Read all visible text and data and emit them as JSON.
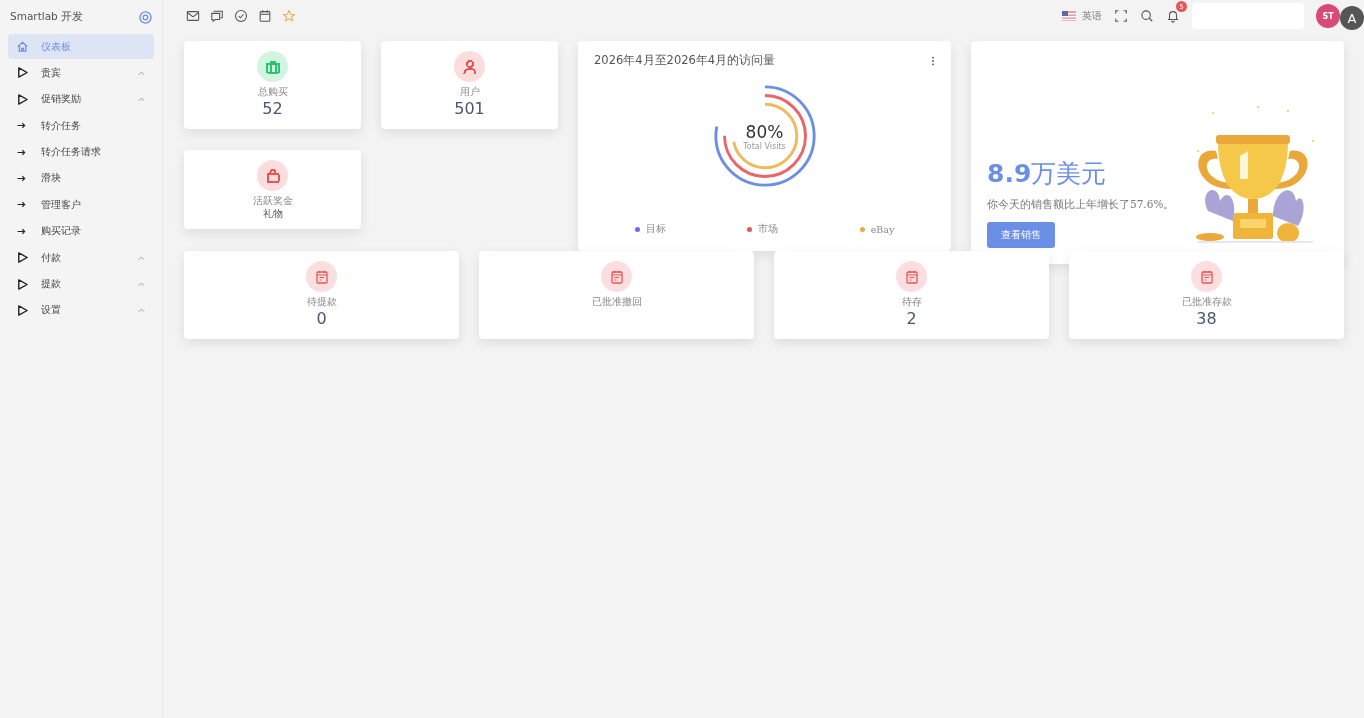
{
  "sidebar": {
    "brand": "Smartlab 开发",
    "items": [
      {
        "label": "仪表板",
        "kind": "home",
        "selected": true
      },
      {
        "label": "贵宾",
        "kind": "group",
        "selected": false
      },
      {
        "label": "促销奖励",
        "kind": "group",
        "selected": false,
        "children": [
          {
            "label": "转介任务",
            "kind": "link",
            "selected": false
          },
          {
            "label": "转介任务请求",
            "kind": "link",
            "selected": false
          },
          {
            "label": "滑块",
            "kind": "link",
            "selected": false
          },
          {
            "label": "管理客户",
            "kind": "link",
            "selected": false
          },
          {
            "label": "购买记录",
            "kind": "link",
            "selected": false
          }
        ]
      },
      {
        "label": "付款",
        "kind": "group",
        "selected": false
      },
      {
        "label": "提款",
        "kind": "group",
        "selected": false
      },
      {
        "label": "设置",
        "kind": "group",
        "selected": false
      }
    ]
  },
  "header": {
    "language": "英语",
    "notifications": "5",
    "avatar": "ST",
    "translate_button": "A"
  },
  "stat_cards": [
    {
      "kind": "briefcase",
      "color": "#28c76f",
      "label": "总购买",
      "value": "52"
    },
    {
      "kind": "user",
      "color": "#ea5455",
      "label": "用户",
      "value": "501"
    },
    {
      "kind": "bag",
      "color": "#ea5455",
      "label": "活跃奖金",
      "sublabel": "礼物"
    }
  ],
  "visits": {
    "title": "2026年4月至2026年4月的访问量",
    "center_value": "80%",
    "center_label": "Total Visits",
    "legend": [
      {
        "label": "目标",
        "color": "#7367f0"
      },
      {
        "label": "市场",
        "color": "#ea5455"
      },
      {
        "label": "eBay",
        "color": "#f0a742"
      }
    ]
  },
  "sales": {
    "amount": "8.9",
    "unit": "万美元",
    "text": "你今天的销售额比上年增长了57.6%。",
    "button": "查看销售"
  },
  "bottom_cards": [
    {
      "label": "待提款",
      "value": "0"
    },
    {
      "label": "已批准撤回"
    },
    {
      "label": "待存",
      "value": "2"
    },
    {
      "label": "已批准存款",
      "value": "38"
    }
  ]
}
